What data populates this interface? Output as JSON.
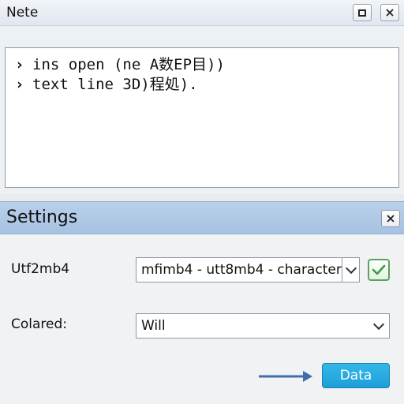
{
  "note_window": {
    "title": "Nete",
    "maximize_icon": "maximize-icon",
    "close_icon": "close-icon",
    "editor": {
      "lines": [
        {
          "prompt": "›",
          "text": "ins open (ne A数EP目))"
        },
        {
          "prompt": "›",
          "text": "text  line 3D)程処)."
        }
      ]
    }
  },
  "settings": {
    "title": "Settings",
    "close_icon": "close-icon",
    "charset": {
      "label": "Utf2mb4",
      "value": "mfimb4 - utt8mb4 - character",
      "confirm_icon": "check-icon"
    },
    "colored": {
      "label": "Colared:",
      "value": "Will"
    },
    "arrow_icon": "arrow-right-icon",
    "arrow_color": "#3d6fb0",
    "button_label": "Data",
    "button_color": "#1c9fd9"
  }
}
